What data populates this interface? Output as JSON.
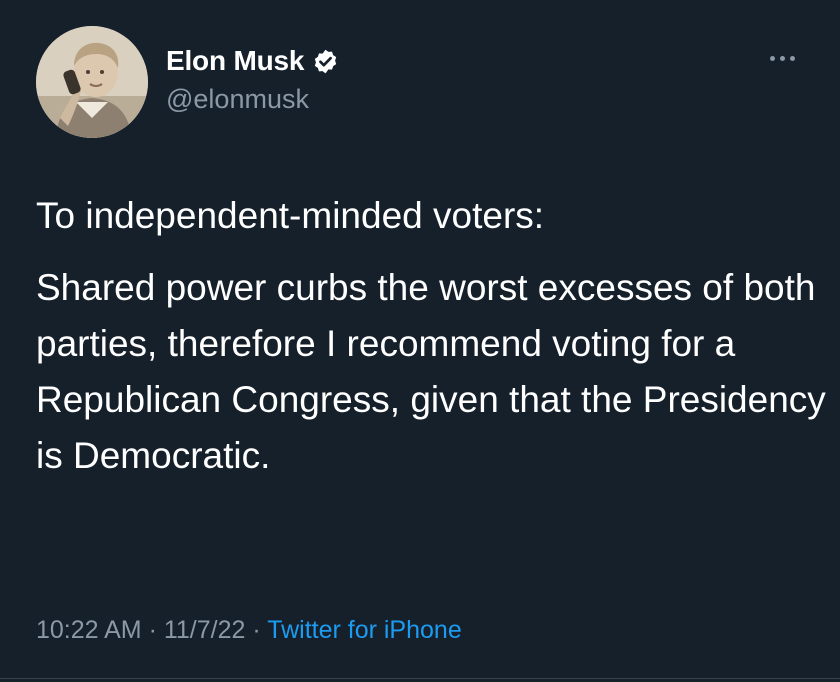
{
  "tweet": {
    "author": {
      "display_name": "Elon Musk",
      "handle": "@elonmusk",
      "verified": true,
      "avatar_icon": "child-on-phone-photo"
    },
    "text": {
      "line1": "To independent-minded voters:",
      "body": "Shared power curbs the worst excesses of both parties, therefore I recommend voting for a Republican Congress, given that the Presidency is Democratic."
    },
    "meta": {
      "time": "10:22 AM",
      "sep1": " · ",
      "date": "11/7/22",
      "sep2": " · ",
      "source": "Twitter for iPhone"
    }
  },
  "colors": {
    "background": "#15202b",
    "text": "#ffffff",
    "secondary": "#8b98a5",
    "link": "#1d9bf0"
  }
}
